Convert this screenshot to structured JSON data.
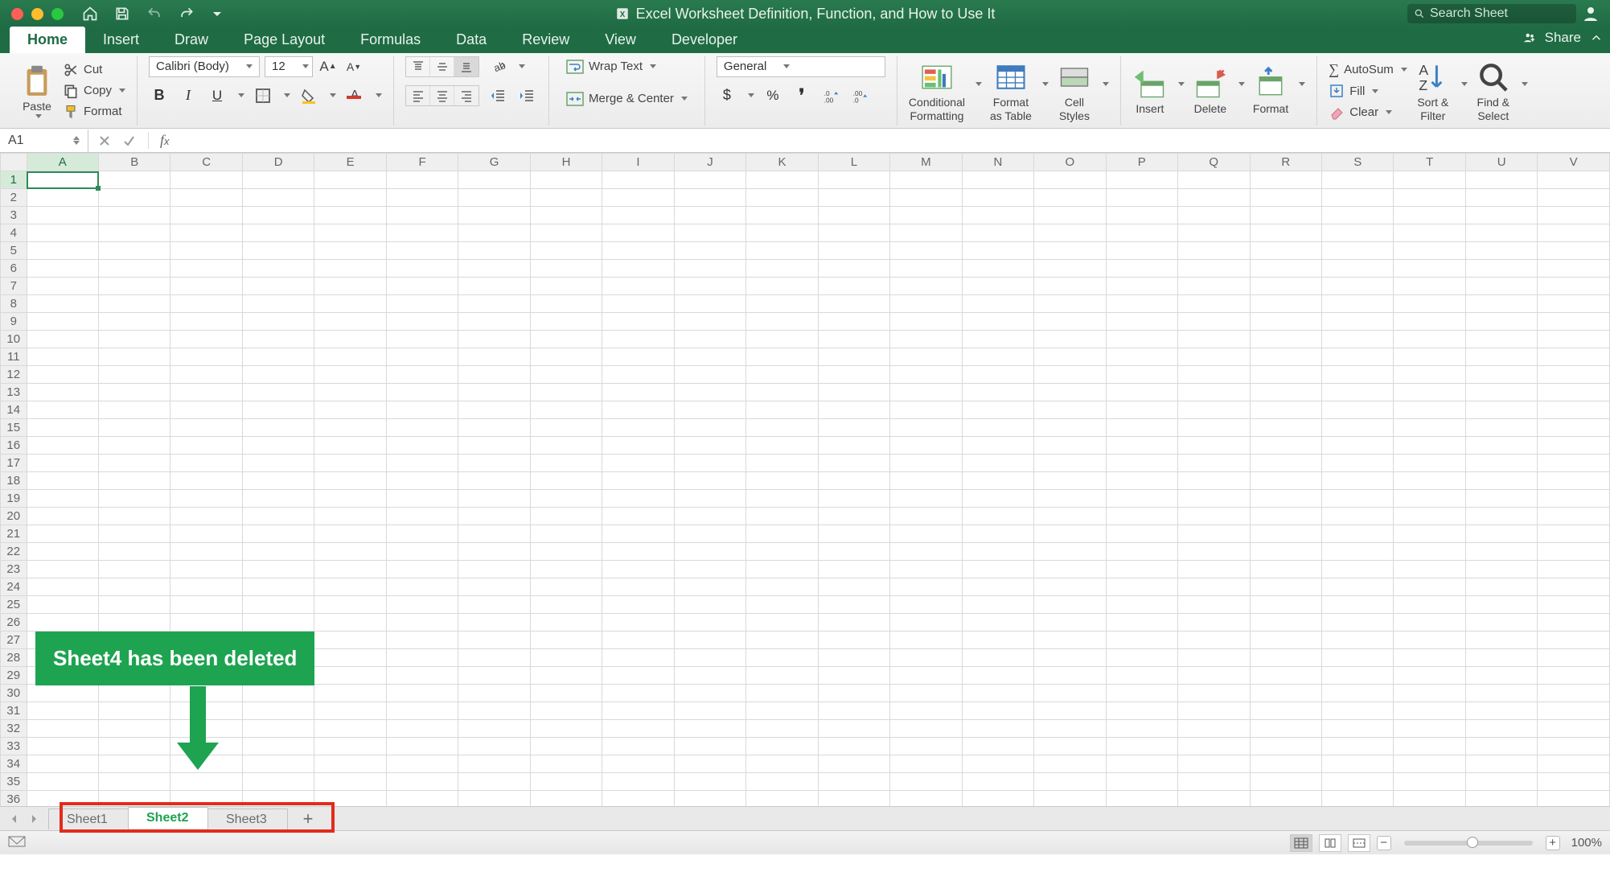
{
  "window": {
    "title": "Excel Worksheet Definition, Function, and How to Use It",
    "search_placeholder": "Search Sheet",
    "share_label": "Share"
  },
  "menu_tabs": [
    "Home",
    "Insert",
    "Draw",
    "Page Layout",
    "Formulas",
    "Data",
    "Review",
    "View",
    "Developer"
  ],
  "active_menu_tab": 0,
  "ribbon": {
    "paste_label": "Paste",
    "cut_label": "Cut",
    "copy_label": "Copy",
    "format_label": "Format",
    "font_name": "Calibri (Body)",
    "font_size": "12",
    "wrap_text": "Wrap Text",
    "merge_center": "Merge & Center",
    "number_format": "General",
    "cond_fmt_l1": "Conditional",
    "cond_fmt_l2": "Formatting",
    "fmt_table_l1": "Format",
    "fmt_table_l2": "as Table",
    "cell_styles_l1": "Cell",
    "cell_styles_l2": "Styles",
    "insert": "Insert",
    "delete": "Delete",
    "format_cells": "Format",
    "autosum": "AutoSum",
    "fill": "Fill",
    "clear": "Clear",
    "sort_filter_l1": "Sort &",
    "sort_filter_l2": "Filter",
    "find_select_l1": "Find &",
    "find_select_l2": "Select"
  },
  "namebox": "A1",
  "columns": [
    "A",
    "B",
    "C",
    "D",
    "E",
    "F",
    "G",
    "H",
    "I",
    "J",
    "K",
    "L",
    "M",
    "N",
    "O",
    "P",
    "Q",
    "R",
    "S",
    "T",
    "U",
    "V"
  ],
  "rows": 36,
  "selected_cell": {
    "col": 0,
    "row": 0
  },
  "callout_text": "Sheet4 has been deleted",
  "sheet_tabs": [
    "Sheet1",
    "Sheet2",
    "Sheet3"
  ],
  "active_sheet_tab": 1,
  "zoom": "100%"
}
